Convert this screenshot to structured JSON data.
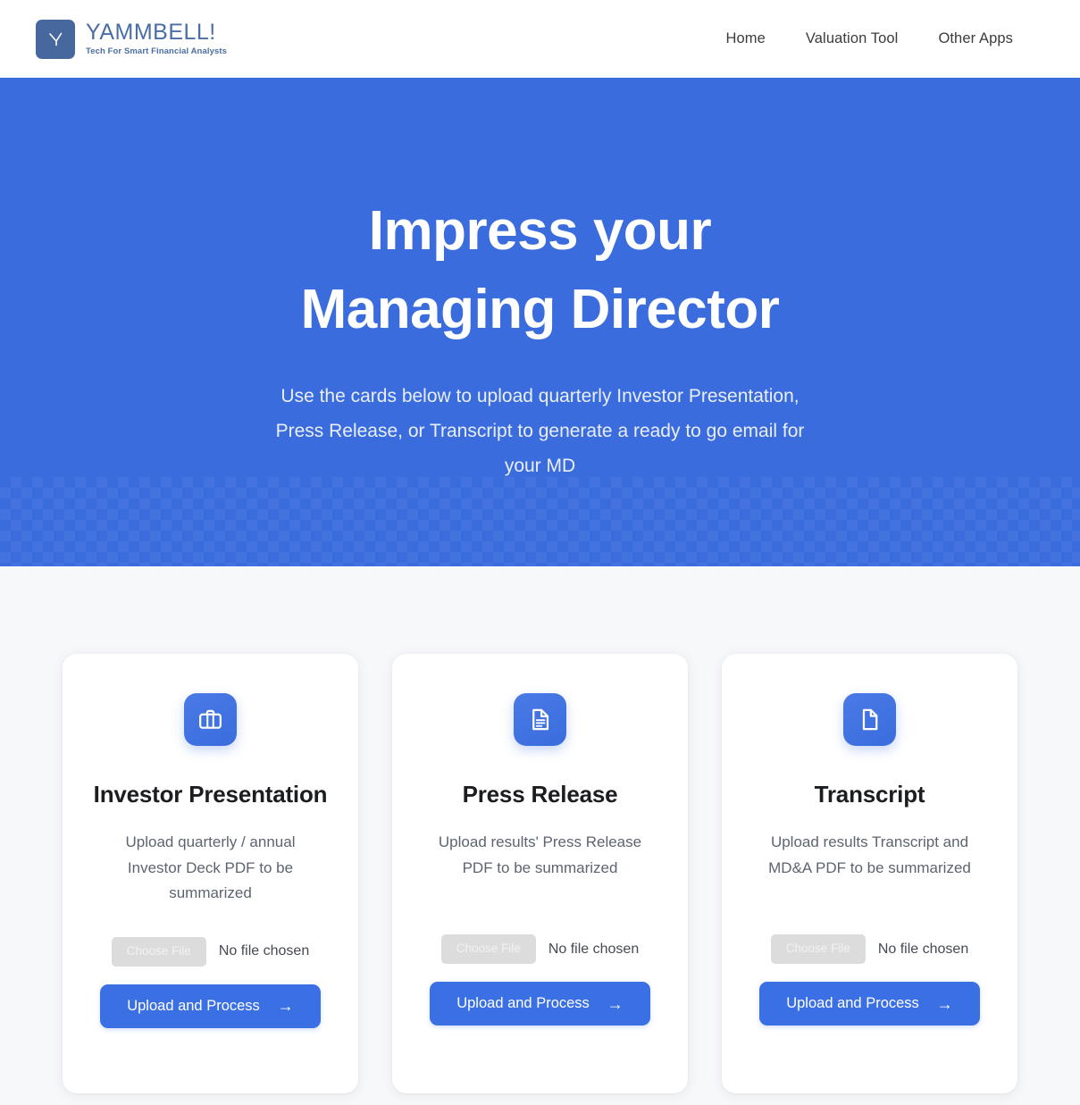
{
  "brand": {
    "name": "YAMMBELL!",
    "tagline": "Tech For Smart Financial Analysts",
    "mark_icon": "clock-hands-icon",
    "mark_color": "#47689f",
    "name_color": "#4a6ea5"
  },
  "nav": {
    "links": [
      {
        "label": "Home",
        "name": "nav-link-home"
      },
      {
        "label": "Valuation Tool",
        "name": "nav-link-valuation-tool"
      },
      {
        "label": "Other Apps",
        "name": "nav-link-other-apps"
      }
    ]
  },
  "hero": {
    "title": "Impress your Managing Director",
    "subtitle": "Use the cards below to upload quarterly Investor Presentation, Press Release, or Transcript to generate a ready to go email for your MD",
    "background_color": "#3a6cdd",
    "title_color": "#ffffff"
  },
  "cards": [
    {
      "id": "investor-presentation",
      "icon": "briefcase-icon",
      "title": "Investor Presentation",
      "description": "Upload quarterly / annual Investor Deck PDF to be summarized",
      "choose_file_label": "Choose File",
      "file_status": "No file chosen",
      "submit_label": "Upload and Process",
      "submit_arrow": "→"
    },
    {
      "id": "press-release",
      "icon": "document-lines-icon",
      "title": "Press Release",
      "description": "Upload results' Press Release PDF to be summarized",
      "choose_file_label": "Choose File",
      "file_status": "No file chosen",
      "submit_label": "Upload and Process",
      "submit_arrow": "→"
    },
    {
      "id": "transcript",
      "icon": "document-page-icon",
      "title": "Transcript",
      "description": "Upload results Transcript and MD&A PDF to be summarized",
      "choose_file_label": "Choose File",
      "file_status": "No file chosen",
      "submit_label": "Upload and Process",
      "submit_arrow": "→"
    }
  ],
  "colors": {
    "accent_blue": "#3a6cdd",
    "button_blue": "#3b6fe4",
    "page_background": "#f7f8fa",
    "card_background": "#ffffff",
    "body_text": "#5d6470",
    "heading_text": "#1b1d21",
    "choose_file_gray": "#dcdcdc"
  }
}
